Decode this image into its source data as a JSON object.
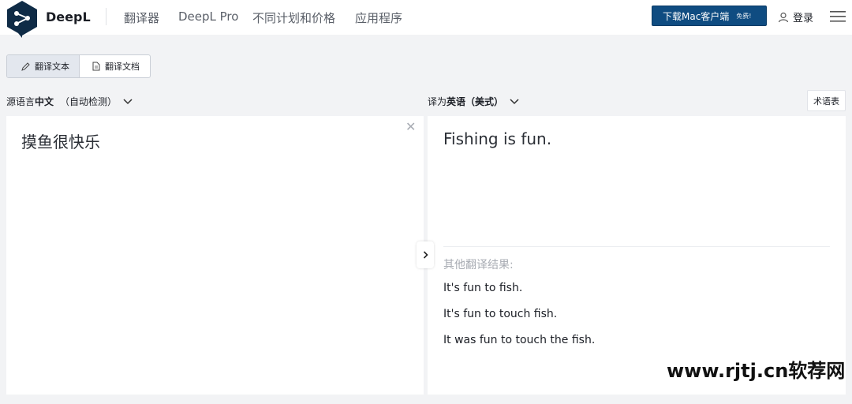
{
  "header": {
    "brand": "DeepL",
    "nav": [
      "翻译器",
      "DeepL Pro",
      "不同计划和价格",
      "应用程序"
    ],
    "download_label": "下载Mac客户端",
    "download_badge": "免费!",
    "login_label": "登录",
    "accent_color": "#0f4c81"
  },
  "mode_tabs": {
    "text_label": "翻译文本",
    "document_label": "翻译文档"
  },
  "source": {
    "prefix": "源语言",
    "language": "中文",
    "detect": "（自动检测）",
    "text": "摸鱼很快乐",
    "clear_icon": "close-icon"
  },
  "target": {
    "prefix": "译为",
    "language": "英语（美式）",
    "glossary_label": "术语表",
    "text": "Fishing is fun.",
    "alternatives_heading": "其他翻译结果:",
    "alternatives": [
      "It's fun to fish.",
      "It's fun to touch fish.",
      "It was fun to touch the fish."
    ]
  },
  "watermark": "www.rjtj.cn软荐网"
}
